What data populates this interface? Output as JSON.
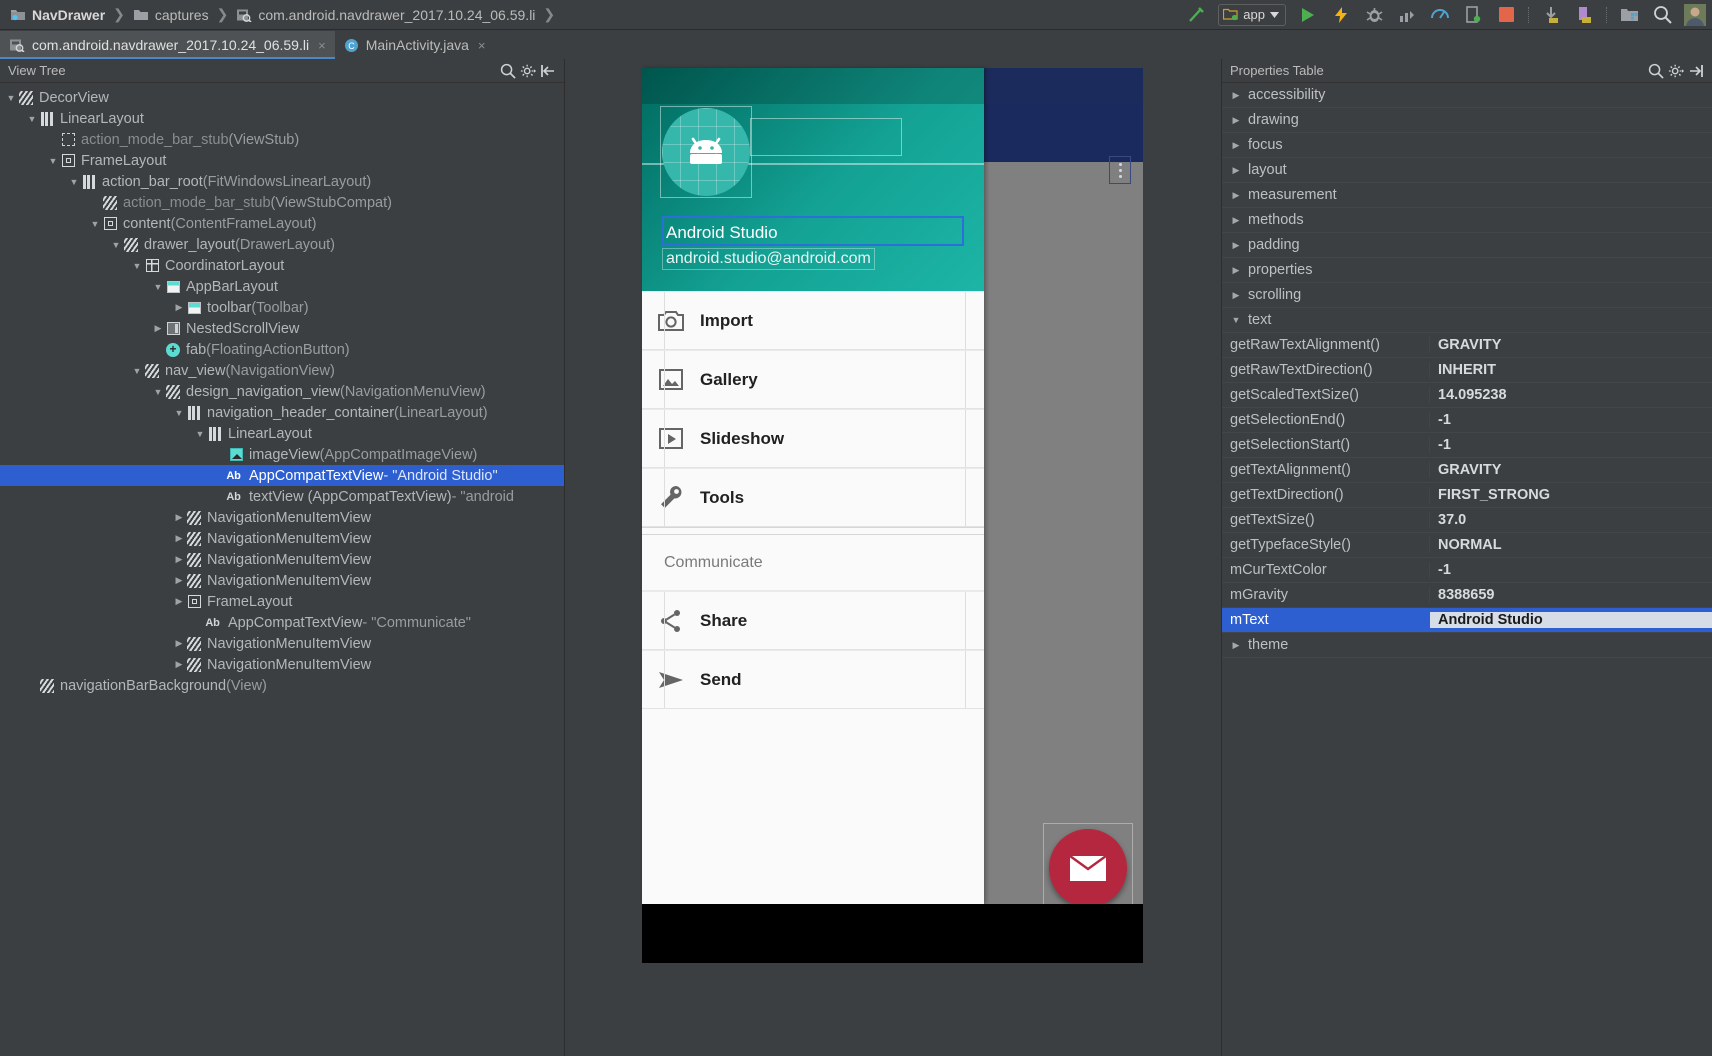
{
  "breadcrumbs": [
    {
      "label": "NavDrawer",
      "icon": "project-folder-icon",
      "bold": true
    },
    {
      "label": "captures",
      "icon": "folder-icon",
      "bold": false
    },
    {
      "label": "com.android.navdrawer_2017.10.24_06.59.li",
      "icon": "layout-capture-icon",
      "bold": false
    }
  ],
  "toolbar": {
    "run_config_label": "app",
    "icons": [
      "build-hammer-icon",
      "run-icon",
      "apply-changes-icon",
      "debug-icon",
      "profile-icon",
      "monitor-icon",
      "avd-manager-icon",
      "stop-icon",
      "sdk-download-icon",
      "device-manager-icon",
      "project-structure-icon",
      "search-icon",
      "avatar-icon"
    ]
  },
  "tabs": [
    {
      "label": "com.android.navdrawer_2017.10.24_06.59.li",
      "icon": "layout-capture-icon",
      "active": true,
      "close": "×"
    },
    {
      "label": "MainActivity.java",
      "icon": "java-class-icon",
      "active": false,
      "close": "×"
    }
  ],
  "view_tree": {
    "title": "View Tree",
    "header_icons": [
      "search-icon",
      "settings-gear-icon",
      "collapse-all-icon"
    ],
    "rows": [
      {
        "indent": 0,
        "arrow": "down",
        "icon": "hatch",
        "name": "DecorView",
        "suffix": "",
        "dim": false,
        "selected": false
      },
      {
        "indent": 1,
        "arrow": "down",
        "icon": "bars",
        "name": "LinearLayout",
        "suffix": "",
        "dim": false,
        "selected": false
      },
      {
        "indent": 2,
        "arrow": "none",
        "icon": "dashsq",
        "name": "action_mode_bar_stub",
        "suffix": " (ViewStub)",
        "dim": true,
        "selected": false
      },
      {
        "indent": 2,
        "arrow": "down",
        "icon": "sqicon",
        "name": "FrameLayout",
        "suffix": "",
        "dim": false,
        "selected": false
      },
      {
        "indent": 3,
        "arrow": "down",
        "icon": "bars",
        "name": "action_bar_root",
        "suffix": " (FitWindowsLinearLayout)",
        "dim": false,
        "selected": false
      },
      {
        "indent": 4,
        "arrow": "none",
        "icon": "hatch",
        "name": "action_mode_bar_stub",
        "suffix": " (ViewStubCompat)",
        "dim": true,
        "selected": false
      },
      {
        "indent": 4,
        "arrow": "down",
        "icon": "sqicon",
        "name": "content",
        "suffix": " (ContentFrameLayout)",
        "dim": false,
        "selected": false
      },
      {
        "indent": 5,
        "arrow": "down",
        "icon": "hatch",
        "name": "drawer_layout",
        "suffix": " (DrawerLayout)",
        "dim": false,
        "selected": false
      },
      {
        "indent": 6,
        "arrow": "down",
        "icon": "gridicon",
        "name": "CoordinatorLayout",
        "suffix": "",
        "dim": false,
        "selected": false
      },
      {
        "indent": 7,
        "arrow": "down",
        "icon": "tealtop1",
        "name": "AppBarLayout",
        "suffix": "",
        "dim": false,
        "selected": false
      },
      {
        "indent": 8,
        "arrow": "right",
        "icon": "tealtop2",
        "name": "toolbar",
        "suffix": " (Toolbar)",
        "dim": false,
        "selected": false
      },
      {
        "indent": 7,
        "arrow": "right",
        "icon": "nsv",
        "name": "NestedScrollView",
        "suffix": "",
        "dim": false,
        "selected": false
      },
      {
        "indent": 7,
        "arrow": "none",
        "icon": "plus",
        "name": "fab",
        "suffix": " (FloatingActionButton)",
        "dim": false,
        "selected": false
      },
      {
        "indent": 6,
        "arrow": "down",
        "icon": "hatch",
        "name": "nav_view",
        "suffix": " (NavigationView)",
        "dim": false,
        "selected": false
      },
      {
        "indent": 7,
        "arrow": "down",
        "icon": "hatch",
        "name": "design_navigation_view",
        "suffix": " (NavigationMenuView)",
        "dim": false,
        "selected": false
      },
      {
        "indent": 8,
        "arrow": "down",
        "icon": "bars",
        "name": "navigation_header_container",
        "suffix": " (LinearLayout)",
        "dim": false,
        "selected": false
      },
      {
        "indent": 9,
        "arrow": "down",
        "icon": "bars",
        "name": "LinearLayout",
        "suffix": "",
        "dim": false,
        "selected": false
      },
      {
        "indent": 10,
        "arrow": "none",
        "icon": "imgicon",
        "name": "imageView",
        "suffix": " (AppCompatImageView)",
        "dim": false,
        "selected": false
      },
      {
        "indent": 10,
        "arrow": "none",
        "icon": "ab",
        "name": "AppCompatTextView",
        "suffix": " - \"Android Studio\"",
        "dim": false,
        "selected": true
      },
      {
        "indent": 10,
        "arrow": "none",
        "icon": "ab",
        "name": "textView (AppCompatTextView)",
        "suffix": " - \"android",
        "dim": false,
        "selected": false
      },
      {
        "indent": 8,
        "arrow": "right",
        "icon": "hatch",
        "name": "NavigationMenuItemView",
        "suffix": "",
        "dim": false,
        "selected": false
      },
      {
        "indent": 8,
        "arrow": "right",
        "icon": "hatch",
        "name": "NavigationMenuItemView",
        "suffix": "",
        "dim": false,
        "selected": false
      },
      {
        "indent": 8,
        "arrow": "right",
        "icon": "hatch",
        "name": "NavigationMenuItemView",
        "suffix": "",
        "dim": false,
        "selected": false
      },
      {
        "indent": 8,
        "arrow": "right",
        "icon": "hatch",
        "name": "NavigationMenuItemView",
        "suffix": "",
        "dim": false,
        "selected": false
      },
      {
        "indent": 8,
        "arrow": "right",
        "icon": "sqicon",
        "name": "FrameLayout",
        "suffix": "",
        "dim": false,
        "selected": false
      },
      {
        "indent": 9,
        "arrow": "none",
        "icon": "ab",
        "name": "AppCompatTextView",
        "suffix": " - \"Communicate\"",
        "dim": false,
        "selected": false
      },
      {
        "indent": 8,
        "arrow": "right",
        "icon": "hatch",
        "name": "NavigationMenuItemView",
        "suffix": "",
        "dim": false,
        "selected": false
      },
      {
        "indent": 8,
        "arrow": "right",
        "icon": "hatch",
        "name": "NavigationMenuItemView",
        "suffix": "",
        "dim": false,
        "selected": false
      },
      {
        "indent": 1,
        "arrow": "none",
        "icon": "hatch",
        "name": "navigationBarBackground",
        "suffix": " (View)",
        "dim": false,
        "selected": false
      }
    ]
  },
  "preview": {
    "header": {
      "name": "Android Studio",
      "email": "android.studio@android.com",
      "avatar_icon": "android-robot-icon"
    },
    "menu": [
      {
        "label": "Import",
        "icon": "camera-icon"
      },
      {
        "label": "Gallery",
        "icon": "image-icon"
      },
      {
        "label": "Slideshow",
        "icon": "slideshow-icon"
      },
      {
        "label": "Tools",
        "icon": "wrench-icon"
      }
    ],
    "section_header": "Communicate",
    "menu2": [
      {
        "label": "Share",
        "icon": "share-icon"
      },
      {
        "label": "Send",
        "icon": "send-icon"
      }
    ],
    "fab_icon": "email-icon",
    "overflow_icon": "overflow-menu-icon",
    "colors": {
      "drawer_header": "#13a294",
      "status_bar": "#1b2b5c",
      "toolbar": "#1a2a5e",
      "fab": "#b5273f",
      "selection_outline": "#2d6fd8"
    }
  },
  "properties": {
    "title": "Properties Table",
    "header_icons": [
      "search-icon",
      "settings-gear-icon",
      "expand-icon"
    ],
    "rows": [
      {
        "kind": "group",
        "arrow": "right",
        "name": "accessibility",
        "value": ""
      },
      {
        "kind": "group",
        "arrow": "right",
        "name": "drawing",
        "value": ""
      },
      {
        "kind": "group",
        "arrow": "right",
        "name": "focus",
        "value": ""
      },
      {
        "kind": "group",
        "arrow": "right",
        "name": "layout",
        "value": ""
      },
      {
        "kind": "group",
        "arrow": "right",
        "name": "measurement",
        "value": ""
      },
      {
        "kind": "group",
        "arrow": "right",
        "name": "methods",
        "value": ""
      },
      {
        "kind": "group",
        "arrow": "right",
        "name": "padding",
        "value": ""
      },
      {
        "kind": "group",
        "arrow": "right",
        "name": "properties",
        "value": ""
      },
      {
        "kind": "group",
        "arrow": "right",
        "name": "scrolling",
        "value": ""
      },
      {
        "kind": "group",
        "arrow": "down",
        "name": "text",
        "value": ""
      },
      {
        "kind": "item",
        "arrow": "none",
        "name": "getRawTextAlignment()",
        "value": "GRAVITY"
      },
      {
        "kind": "item",
        "arrow": "none",
        "name": "getRawTextDirection()",
        "value": "INHERIT"
      },
      {
        "kind": "item",
        "arrow": "none",
        "name": "getScaledTextSize()",
        "value": "14.095238"
      },
      {
        "kind": "item",
        "arrow": "none",
        "name": "getSelectionEnd()",
        "value": "-1"
      },
      {
        "kind": "item",
        "arrow": "none",
        "name": "getSelectionStart()",
        "value": "-1"
      },
      {
        "kind": "item",
        "arrow": "none",
        "name": "getTextAlignment()",
        "value": "GRAVITY"
      },
      {
        "kind": "item",
        "arrow": "none",
        "name": "getTextDirection()",
        "value": "FIRST_STRONG"
      },
      {
        "kind": "item",
        "arrow": "none",
        "name": "getTextSize()",
        "value": "37.0"
      },
      {
        "kind": "item",
        "arrow": "none",
        "name": "getTypefaceStyle()",
        "value": "NORMAL"
      },
      {
        "kind": "item",
        "arrow": "none",
        "name": "mCurTextColor",
        "value": "-1"
      },
      {
        "kind": "item",
        "arrow": "none",
        "name": "mGravity",
        "value": "8388659"
      },
      {
        "kind": "item",
        "arrow": "none",
        "name": "mText",
        "value": "Android Studio",
        "selected": true
      },
      {
        "kind": "group",
        "arrow": "right",
        "name": "theme",
        "value": ""
      }
    ]
  }
}
